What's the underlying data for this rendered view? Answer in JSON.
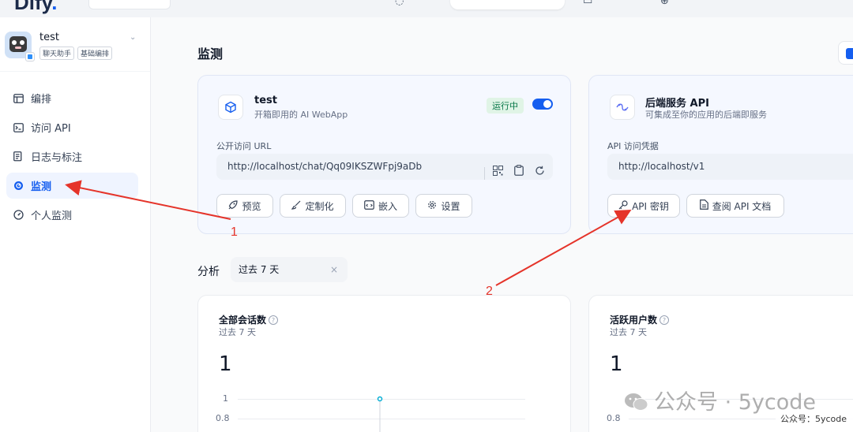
{
  "topbar": {
    "logo": "Dify",
    "logo_dot": "."
  },
  "sidebar": {
    "app_name": "test",
    "tags": [
      "聊天助手",
      "基础编排"
    ],
    "items": [
      {
        "label": "编排",
        "icon": "layout-icon"
      },
      {
        "label": "访问 API",
        "icon": "terminal-icon"
      },
      {
        "label": "日志与标注",
        "icon": "document-icon"
      },
      {
        "label": "监测",
        "icon": "gauge-icon",
        "active": true
      },
      {
        "label": "个人监测",
        "icon": "gauge-outline-icon"
      }
    ]
  },
  "main": {
    "title": "监测",
    "webapp_card": {
      "title": "test",
      "subtitle": "开箱即用的 AI WebApp",
      "status": "运行中",
      "url_label": "公开访问 URL",
      "url": "http://localhost/chat/Qq09IKSZWFpj9aDb",
      "buttons": [
        "预览",
        "定制化",
        "嵌入",
        "设置"
      ]
    },
    "api_card": {
      "title": "后端服务 API",
      "subtitle": "可集成至你的应用的后端即服务",
      "credential_label": "API 访问凭据",
      "url": "http://localhost/v1",
      "buttons": [
        "API 密钥",
        "查阅 API 文档"
      ]
    },
    "analysis": {
      "label": "分析",
      "period": "过去 7 天",
      "clear": "×"
    },
    "stats": [
      {
        "title": "全部会话数",
        "sub": "过去 7 天",
        "value": "1",
        "ticks": [
          "1",
          "0.8"
        ]
      },
      {
        "title": "活跃用户数",
        "sub": "过去 7 天",
        "value": "1",
        "ticks": [
          "1",
          "0.8"
        ]
      }
    ]
  },
  "annotations": {
    "one": "1",
    "two": "2"
  },
  "watermark": {
    "text": "公众号 · 5ycode",
    "badge": "公众号：5ycode"
  },
  "colors": {
    "accent": "#155eef",
    "arrow": "#e5342a",
    "status_bg": "#e0f4e6"
  }
}
